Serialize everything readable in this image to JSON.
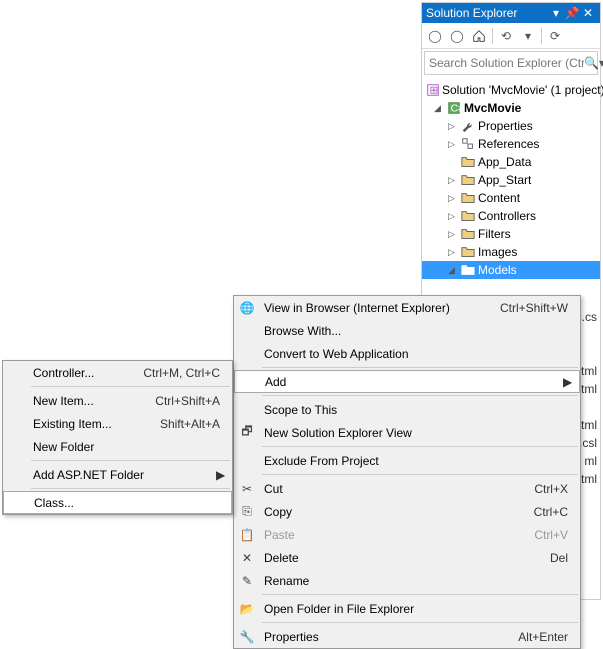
{
  "panel": {
    "title": "Solution Explorer",
    "search_placeholder": "Search Solution Explorer (Ctrl"
  },
  "tree": {
    "solution": "Solution 'MvcMovie' (1 project)",
    "project": "MvcMovie",
    "nodes": [
      {
        "label": "Properties",
        "icon": "wrench"
      },
      {
        "label": "References",
        "icon": "refs"
      },
      {
        "label": "App_Data",
        "icon": "folder",
        "noexp": true
      },
      {
        "label": "App_Start",
        "icon": "folder"
      },
      {
        "label": "Content",
        "icon": "folder"
      },
      {
        "label": "Controllers",
        "icon": "folder"
      },
      {
        "label": "Filters",
        "icon": "folder"
      },
      {
        "label": "Images",
        "icon": "folder"
      },
      {
        "label": "Models",
        "icon": "folder",
        "selected": true,
        "expanded": true
      }
    ]
  },
  "peek_items": [
    "s.cs",
    "",
    "",
    "tml",
    "tml",
    "",
    "shtml",
    "ial.csl",
    "ml",
    "tml"
  ],
  "context_main": [
    {
      "label": "View in Browser (Internet Explorer)",
      "shortcut": "Ctrl+Shift+W",
      "icon": "browser"
    },
    {
      "label": "Browse With..."
    },
    {
      "label": "Convert to Web Application"
    },
    {
      "sep": true
    },
    {
      "label": "Add",
      "arrow": true,
      "hover": true
    },
    {
      "sep": true
    },
    {
      "label": "Scope to This"
    },
    {
      "label": "New Solution Explorer View",
      "icon": "newview"
    },
    {
      "sep": true
    },
    {
      "label": "Exclude From Project"
    },
    {
      "sep": true
    },
    {
      "label": "Cut",
      "shortcut": "Ctrl+X",
      "icon": "cut"
    },
    {
      "label": "Copy",
      "shortcut": "Ctrl+C",
      "icon": "copy"
    },
    {
      "label": "Paste",
      "shortcut": "Ctrl+V",
      "icon": "paste",
      "disabled": true
    },
    {
      "label": "Delete",
      "shortcut": "Del",
      "icon": "delete"
    },
    {
      "label": "Rename",
      "icon": "rename"
    },
    {
      "sep": true
    },
    {
      "label": "Open Folder in File Explorer",
      "icon": "openfolder"
    },
    {
      "sep": true
    },
    {
      "label": "Properties",
      "shortcut": "Alt+Enter",
      "icon": "props"
    }
  ],
  "context_sub": [
    {
      "label": "Controller...",
      "shortcut": "Ctrl+M, Ctrl+C"
    },
    {
      "sep": true
    },
    {
      "label": "New Item...",
      "shortcut": "Ctrl+Shift+A"
    },
    {
      "label": "Existing Item...",
      "shortcut": "Shift+Alt+A"
    },
    {
      "label": "New Folder"
    },
    {
      "sep": true
    },
    {
      "label": "Add ASP.NET Folder",
      "arrow": true
    },
    {
      "sep": true
    },
    {
      "label": "Class...",
      "hover": true
    }
  ]
}
